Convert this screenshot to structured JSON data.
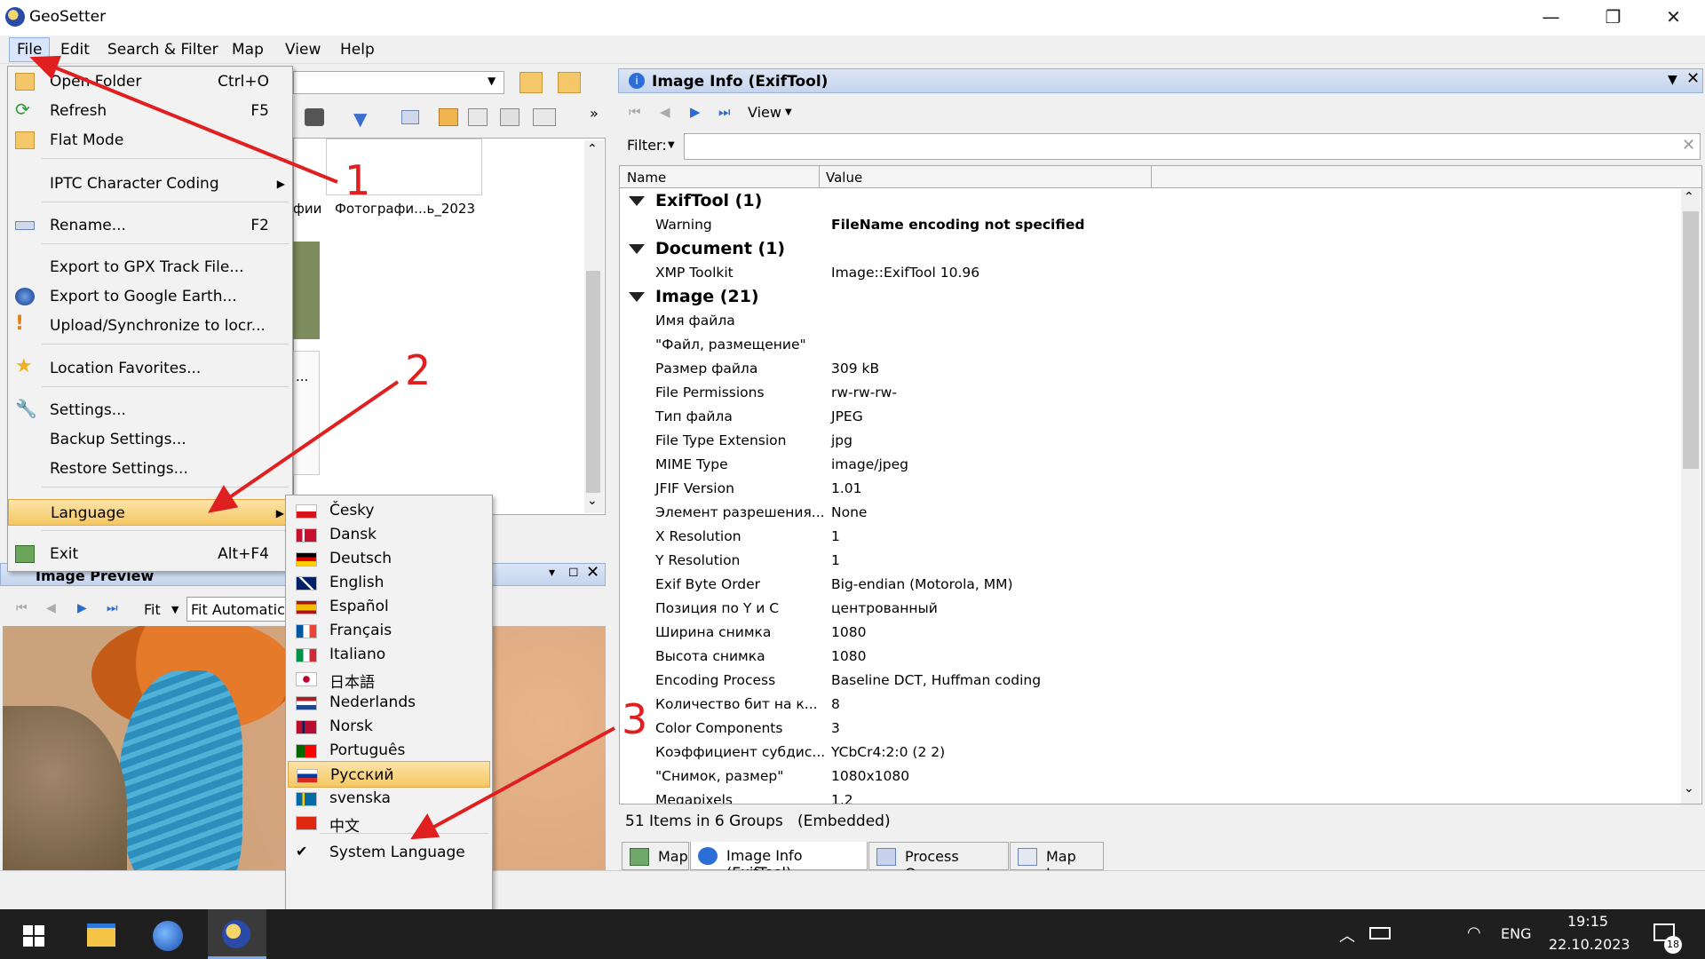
{
  "window": {
    "title": "GeoSetter",
    "controls": [
      "—",
      "❐",
      "✕"
    ]
  },
  "menubar": [
    "File",
    "Edit",
    "Search & Filter",
    "Map",
    "View",
    "Help"
  ],
  "file_menu": {
    "items": [
      {
        "label": "Open Folder",
        "shortcut": "Ctrl+O"
      },
      {
        "label": "Refresh",
        "shortcut": "F5"
      },
      {
        "label": "Flat Mode",
        "shortcut": ""
      },
      {
        "label": "IPTC Character Coding",
        "shortcut": "▶"
      },
      {
        "label": "Rename...",
        "shortcut": "F2"
      },
      {
        "label": "Export to GPX Track File...",
        "shortcut": ""
      },
      {
        "label": "Export to Google Earth...",
        "shortcut": ""
      },
      {
        "label": "Upload/Synchronize to locr...",
        "shortcut": ""
      },
      {
        "label": "Location Favorites...",
        "shortcut": ""
      },
      {
        "label": "Settings...",
        "shortcut": ""
      },
      {
        "label": "Backup Settings...",
        "shortcut": ""
      },
      {
        "label": "Restore Settings...",
        "shortcut": ""
      },
      {
        "label": "Language",
        "shortcut": "▶"
      },
      {
        "label": "Exit",
        "shortcut": "Alt+F4"
      }
    ]
  },
  "language_menu": {
    "items": [
      "Česky",
      "Dansk",
      "Deutsch",
      "English",
      "Español",
      "Français",
      "Italiano",
      "日本語",
      "Nederlands",
      "Norsk",
      "Português",
      "Русский",
      "svenska",
      "中文",
      "System Language"
    ],
    "selected": "Русский",
    "checked": "System Language"
  },
  "browser": {
    "thumb1": "фии",
    "thumb2": "Фотографи...ь_2023",
    "truncated": "..."
  },
  "preview": {
    "title": "Image Preview",
    "fit": "Fit",
    "fit_mode": "Fit Automatic"
  },
  "info": {
    "title": "Image Info (ExifTool)",
    "view_label": "View",
    "filter_label": "Filter:",
    "columns": [
      "Name",
      "Value"
    ],
    "rows": [
      {
        "group": true,
        "name": "ExifTool (1)",
        "value": ""
      },
      {
        "group": false,
        "name": "Warning",
        "value": "FileName encoding not specified",
        "bold": true
      },
      {
        "group": true,
        "name": "Document (1)",
        "value": ""
      },
      {
        "group": false,
        "name": "XMP Toolkit",
        "value": "Image::ExifTool 10.96"
      },
      {
        "group": true,
        "name": "Image (21)",
        "value": ""
      },
      {
        "group": false,
        "name": "Имя файла",
        "value": ""
      },
      {
        "group": false,
        "name": "\"Файл, размещение\"",
        "value": ""
      },
      {
        "group": false,
        "name": "Размер файла",
        "value": "309 kB"
      },
      {
        "group": false,
        "name": "File Permissions",
        "value": "rw-rw-rw-"
      },
      {
        "group": false,
        "name": "Тип файла",
        "value": "JPEG"
      },
      {
        "group": false,
        "name": "File Type Extension",
        "value": "jpg"
      },
      {
        "group": false,
        "name": "MIME Type",
        "value": "image/jpeg"
      },
      {
        "group": false,
        "name": "JFIF Version",
        "value": "1.01"
      },
      {
        "group": false,
        "name": "Элемент разрешения...",
        "value": "None"
      },
      {
        "group": false,
        "name": "X Resolution",
        "value": "1"
      },
      {
        "group": false,
        "name": "Y Resolution",
        "value": "1"
      },
      {
        "group": false,
        "name": "Exif Byte Order",
        "value": "Big-endian (Motorola, MM)"
      },
      {
        "group": false,
        "name": "Позиция по Y и C",
        "value": "центрованный"
      },
      {
        "group": false,
        "name": "Ширина снимка",
        "value": "1080"
      },
      {
        "group": false,
        "name": "Высота снимка",
        "value": "1080"
      },
      {
        "group": false,
        "name": "Encoding Process",
        "value": "Baseline DCT, Huffman coding"
      },
      {
        "group": false,
        "name": "Количество бит на к...",
        "value": "8"
      },
      {
        "group": false,
        "name": "Color Components",
        "value": "3"
      },
      {
        "group": false,
        "name": "Коэффициент субдис...",
        "value": "YCbCr4:2:0 (2 2)"
      },
      {
        "group": false,
        "name": "\"Снимок, размер\"",
        "value": "1080x1080"
      },
      {
        "group": false,
        "name": "Megapixels",
        "value": "1.2"
      }
    ],
    "status": "51 Items in 6 Groups   (Embedded)",
    "tabs": [
      "Map",
      "Image Info (ExifTool)",
      "Process Queue",
      "Map Log"
    ]
  },
  "annotations": [
    "1",
    "2",
    "3"
  ],
  "taskbar": {
    "lang": "ENG",
    "time": "19:15",
    "date": "22.10.2023",
    "notif_count": "18"
  },
  "colors": {
    "accent_highlight": "#f5c863",
    "arrow_red": "#e02020",
    "selection": "#d7e6fb"
  }
}
